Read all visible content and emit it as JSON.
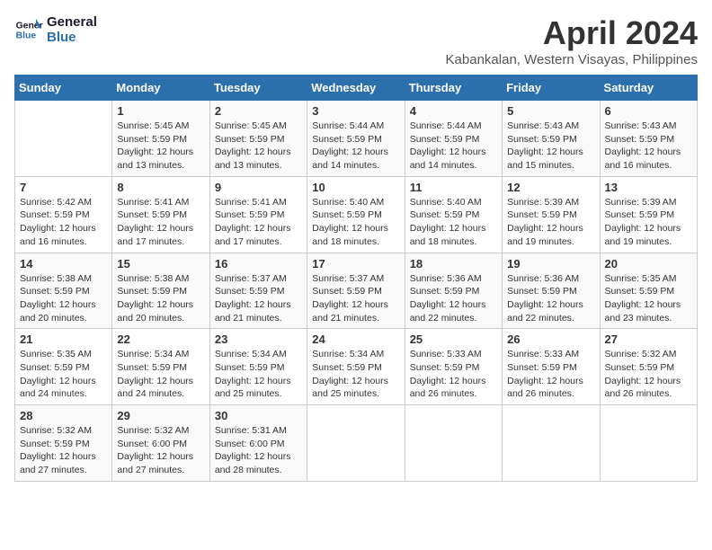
{
  "logo": {
    "line1": "General",
    "line2": "Blue"
  },
  "title": "April 2024",
  "location": "Kabankalan, Western Visayas, Philippines",
  "days_header": [
    "Sunday",
    "Monday",
    "Tuesday",
    "Wednesday",
    "Thursday",
    "Friday",
    "Saturday"
  ],
  "weeks": [
    [
      {
        "day": "",
        "info": ""
      },
      {
        "day": "1",
        "info": "Sunrise: 5:45 AM\nSunset: 5:59 PM\nDaylight: 12 hours\nand 13 minutes."
      },
      {
        "day": "2",
        "info": "Sunrise: 5:45 AM\nSunset: 5:59 PM\nDaylight: 12 hours\nand 13 minutes."
      },
      {
        "day": "3",
        "info": "Sunrise: 5:44 AM\nSunset: 5:59 PM\nDaylight: 12 hours\nand 14 minutes."
      },
      {
        "day": "4",
        "info": "Sunrise: 5:44 AM\nSunset: 5:59 PM\nDaylight: 12 hours\nand 14 minutes."
      },
      {
        "day": "5",
        "info": "Sunrise: 5:43 AM\nSunset: 5:59 PM\nDaylight: 12 hours\nand 15 minutes."
      },
      {
        "day": "6",
        "info": "Sunrise: 5:43 AM\nSunset: 5:59 PM\nDaylight: 12 hours\nand 16 minutes."
      }
    ],
    [
      {
        "day": "7",
        "info": "Sunrise: 5:42 AM\nSunset: 5:59 PM\nDaylight: 12 hours\nand 16 minutes."
      },
      {
        "day": "8",
        "info": "Sunrise: 5:41 AM\nSunset: 5:59 PM\nDaylight: 12 hours\nand 17 minutes."
      },
      {
        "day": "9",
        "info": "Sunrise: 5:41 AM\nSunset: 5:59 PM\nDaylight: 12 hours\nand 17 minutes."
      },
      {
        "day": "10",
        "info": "Sunrise: 5:40 AM\nSunset: 5:59 PM\nDaylight: 12 hours\nand 18 minutes."
      },
      {
        "day": "11",
        "info": "Sunrise: 5:40 AM\nSunset: 5:59 PM\nDaylight: 12 hours\nand 18 minutes."
      },
      {
        "day": "12",
        "info": "Sunrise: 5:39 AM\nSunset: 5:59 PM\nDaylight: 12 hours\nand 19 minutes."
      },
      {
        "day": "13",
        "info": "Sunrise: 5:39 AM\nSunset: 5:59 PM\nDaylight: 12 hours\nand 19 minutes."
      }
    ],
    [
      {
        "day": "14",
        "info": "Sunrise: 5:38 AM\nSunset: 5:59 PM\nDaylight: 12 hours\nand 20 minutes."
      },
      {
        "day": "15",
        "info": "Sunrise: 5:38 AM\nSunset: 5:59 PM\nDaylight: 12 hours\nand 20 minutes."
      },
      {
        "day": "16",
        "info": "Sunrise: 5:37 AM\nSunset: 5:59 PM\nDaylight: 12 hours\nand 21 minutes."
      },
      {
        "day": "17",
        "info": "Sunrise: 5:37 AM\nSunset: 5:59 PM\nDaylight: 12 hours\nand 21 minutes."
      },
      {
        "day": "18",
        "info": "Sunrise: 5:36 AM\nSunset: 5:59 PM\nDaylight: 12 hours\nand 22 minutes."
      },
      {
        "day": "19",
        "info": "Sunrise: 5:36 AM\nSunset: 5:59 PM\nDaylight: 12 hours\nand 22 minutes."
      },
      {
        "day": "20",
        "info": "Sunrise: 5:35 AM\nSunset: 5:59 PM\nDaylight: 12 hours\nand 23 minutes."
      }
    ],
    [
      {
        "day": "21",
        "info": "Sunrise: 5:35 AM\nSunset: 5:59 PM\nDaylight: 12 hours\nand 24 minutes."
      },
      {
        "day": "22",
        "info": "Sunrise: 5:34 AM\nSunset: 5:59 PM\nDaylight: 12 hours\nand 24 minutes."
      },
      {
        "day": "23",
        "info": "Sunrise: 5:34 AM\nSunset: 5:59 PM\nDaylight: 12 hours\nand 25 minutes."
      },
      {
        "day": "24",
        "info": "Sunrise: 5:34 AM\nSunset: 5:59 PM\nDaylight: 12 hours\nand 25 minutes."
      },
      {
        "day": "25",
        "info": "Sunrise: 5:33 AM\nSunset: 5:59 PM\nDaylight: 12 hours\nand 26 minutes."
      },
      {
        "day": "26",
        "info": "Sunrise: 5:33 AM\nSunset: 5:59 PM\nDaylight: 12 hours\nand 26 minutes."
      },
      {
        "day": "27",
        "info": "Sunrise: 5:32 AM\nSunset: 5:59 PM\nDaylight: 12 hours\nand 26 minutes."
      }
    ],
    [
      {
        "day": "28",
        "info": "Sunrise: 5:32 AM\nSunset: 5:59 PM\nDaylight: 12 hours\nand 27 minutes."
      },
      {
        "day": "29",
        "info": "Sunrise: 5:32 AM\nSunset: 6:00 PM\nDaylight: 12 hours\nand 27 minutes."
      },
      {
        "day": "30",
        "info": "Sunrise: 5:31 AM\nSunset: 6:00 PM\nDaylight: 12 hours\nand 28 minutes."
      },
      {
        "day": "",
        "info": ""
      },
      {
        "day": "",
        "info": ""
      },
      {
        "day": "",
        "info": ""
      },
      {
        "day": "",
        "info": ""
      }
    ]
  ]
}
